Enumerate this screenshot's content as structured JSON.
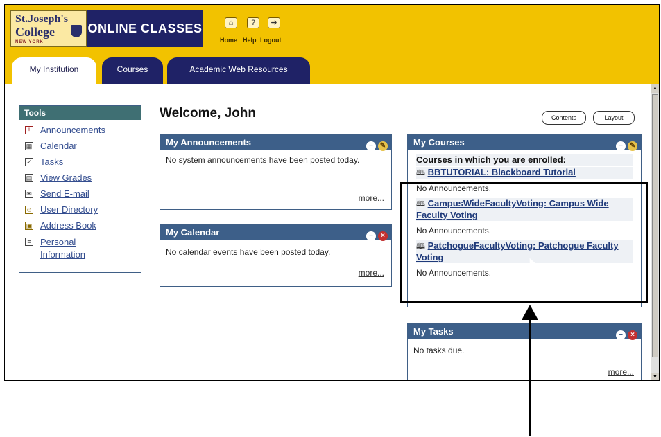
{
  "banner": {
    "logo_line1": "St.Joseph's",
    "logo_line2": "College",
    "logo_line3": "NEW YORK",
    "title": "ONLINE CLASSES",
    "nav": [
      {
        "label": "Home",
        "icon": "home-icon"
      },
      {
        "label": "Help",
        "icon": "help-icon"
      },
      {
        "label": "Logout",
        "icon": "logout-icon"
      }
    ]
  },
  "tabs": [
    {
      "label": "My Institution",
      "active": true
    },
    {
      "label": "Courses",
      "active": false
    },
    {
      "label": "Academic Web Resources",
      "active": false
    }
  ],
  "tools": {
    "title": "Tools",
    "items": [
      {
        "label": "Announcements",
        "icon": "announcement-icon"
      },
      {
        "label": "Calendar",
        "icon": "calendar-icon"
      },
      {
        "label": "Tasks",
        "icon": "tasks-icon"
      },
      {
        "label": "View Grades",
        "icon": "grades-icon"
      },
      {
        "label": "Send E-mail",
        "icon": "email-icon"
      },
      {
        "label": "User Directory",
        "icon": "user-directory-icon"
      },
      {
        "label": "Address Book",
        "icon": "address-book-icon"
      },
      {
        "label": "Personal Information",
        "icon": "personal-info-icon"
      }
    ]
  },
  "welcome": "Welcome, John",
  "buttons": {
    "contents": "Contents",
    "layout": "Layout"
  },
  "announcements": {
    "title": "My Announcements",
    "body": "No system announcements have been posted today.",
    "more": "more..."
  },
  "calendar": {
    "title": "My Calendar",
    "body": "No calendar events have been posted today.",
    "more": "more..."
  },
  "courses": {
    "title": "My Courses",
    "subtitle": "Courses in which you are enrolled:",
    "list": [
      {
        "name": "BBTUTORIAL: Blackboard Tutorial",
        "status": "No Announcements."
      },
      {
        "name": "CampusWideFacultyVoting: Campus Wide Faculty Voting",
        "status": "No Announcements."
      },
      {
        "name": "PatchogueFacultyVoting: Patchogue Faculty Voting",
        "status": "No Announcements."
      }
    ]
  },
  "tasks": {
    "title": "My Tasks",
    "body": "No tasks due.",
    "more": "more..."
  },
  "colors": {
    "banner": "#f2c200",
    "navy": "#1f2266",
    "module_header": "#3d5f89",
    "tools_header": "#3f6f73"
  }
}
